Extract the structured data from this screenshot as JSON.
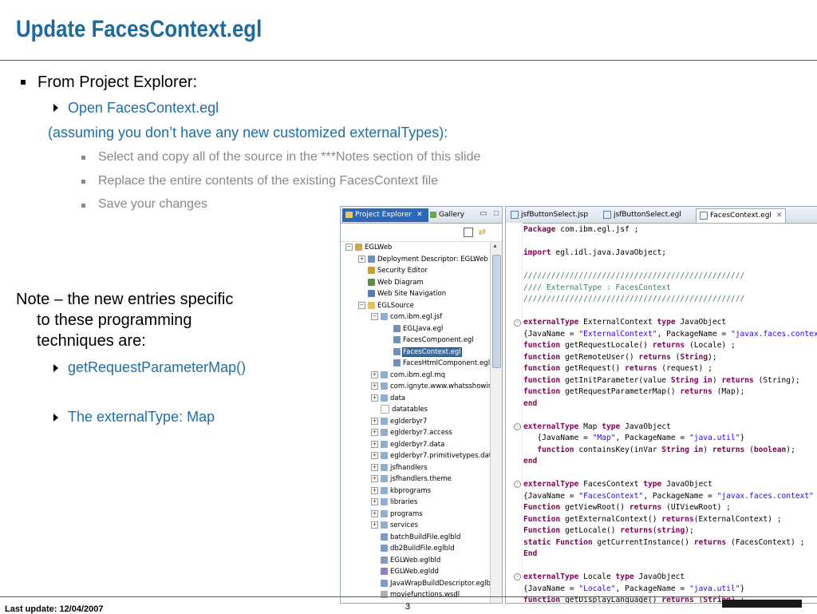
{
  "slide": {
    "title": "Update FacesContext.egl",
    "footer_left": "Last update: 12/04/2007",
    "page_number": "3"
  },
  "bullets": {
    "b1": "From Project Explorer:",
    "b1_sub1": "Open FacesContext.egl",
    "b1_note": "(assuming you don’t have any new customized externalTypes):",
    "b1_sub2_1": "Select  and copy all of the source in the ***Notes section of this slide",
    "b1_sub2_2": "Replace the entire contents of the existing FacesContext file",
    "b1_sub2_3": "Save your changes",
    "note_line1": "Note – the new entries specific",
    "note_line2": "to these programming",
    "note_line3": "techniques are:",
    "note_sub1": "getRequestParameterMap()",
    "note_sub2": "The externalType: Map"
  },
  "project_explorer": {
    "tab_active": "Project Explorer",
    "tab_other": "Gallery",
    "tree": [
      {
        "label": "EGLWeb",
        "indent": 0,
        "expander": "−",
        "icon": "project"
      },
      {
        "label": "Deployment Descriptor: EGLWeb",
        "indent": 1,
        "expander": "+",
        "icon": "descriptor"
      },
      {
        "label": "Security Editor",
        "indent": 1,
        "expander": "",
        "icon": "security"
      },
      {
        "label": "Web Diagram",
        "indent": 1,
        "expander": "",
        "icon": "diagram"
      },
      {
        "label": "Web Site Navigation",
        "indent": 1,
        "expander": "",
        "icon": "navigation"
      },
      {
        "label": "EGLSource",
        "indent": 1,
        "expander": "−",
        "icon": "folder"
      },
      {
        "label": "com.ibm.egl.jsf",
        "indent": 2,
        "expander": "−",
        "icon": "package"
      },
      {
        "label": "EGLJava.egl",
        "indent": 3,
        "expander": "",
        "icon": "file"
      },
      {
        "label": "FacesComponent.egl",
        "indent": 3,
        "expander": "",
        "icon": "file"
      },
      {
        "label": "FacesContext.egl",
        "indent": 3,
        "expander": "",
        "icon": "file",
        "selected": true
      },
      {
        "label": "FacesHtmlComponent.egl",
        "indent": 3,
        "expander": "",
        "icon": "file"
      },
      {
        "label": "com.ibm.egl.mq",
        "indent": 2,
        "expander": "+",
        "icon": "package"
      },
      {
        "label": "com.ignyte.www.whatsshowing",
        "indent": 2,
        "expander": "+",
        "icon": "package"
      },
      {
        "label": "data",
        "indent": 2,
        "expander": "+",
        "icon": "package"
      },
      {
        "label": "datatables",
        "indent": 2,
        "expander": "",
        "icon": "package-empty"
      },
      {
        "label": "eglderbyr7",
        "indent": 2,
        "expander": "+",
        "icon": "package"
      },
      {
        "label": "eglderbyr7.access",
        "indent": 2,
        "expander": "+",
        "icon": "package"
      },
      {
        "label": "eglderbyr7.data",
        "indent": 2,
        "expander": "+",
        "icon": "package"
      },
      {
        "label": "eglderbyr7.primitivetypes.data",
        "indent": 2,
        "expander": "+",
        "icon": "package"
      },
      {
        "label": "jsfhandlers",
        "indent": 2,
        "expander": "+",
        "icon": "package"
      },
      {
        "label": "jsfhandlers.theme",
        "indent": 2,
        "expander": "+",
        "icon": "package"
      },
      {
        "label": "kbprograms",
        "indent": 2,
        "expander": "+",
        "icon": "package"
      },
      {
        "label": "libraries",
        "indent": 2,
        "expander": "+",
        "icon": "package"
      },
      {
        "label": "programs",
        "indent": 2,
        "expander": "+",
        "icon": "package"
      },
      {
        "label": "services",
        "indent": 2,
        "expander": "+",
        "icon": "package"
      },
      {
        "label": "batchBuildFile.eglbld",
        "indent": 2,
        "expander": "",
        "icon": "build"
      },
      {
        "label": "db2BuildFile.eglbld",
        "indent": 2,
        "expander": "",
        "icon": "build"
      },
      {
        "label": "EGLWeb.eglbld",
        "indent": 2,
        "expander": "",
        "icon": "build"
      },
      {
        "label": "EGLWeb.egldd",
        "indent": 2,
        "expander": "",
        "icon": "deploy"
      },
      {
        "label": "JavaWrapBuildDescriptor.eglbld",
        "indent": 2,
        "expander": "",
        "icon": "build"
      },
      {
        "label": "moviefunctions.wsdl",
        "indent": 2,
        "expander": "",
        "icon": "wsdl"
      }
    ]
  },
  "editor": {
    "tabs": [
      "jsfButtonSelect.jsp",
      "jsfButtonSelect.egl",
      "FacesContext.egl"
    ],
    "active_tab": "FacesContext.egl",
    "lines": [
      [
        [
          "kw",
          "Package"
        ],
        [
          "",
          " com.ibm.egl.jsf ;"
        ]
      ],
      [
        [
          "",
          ""
        ]
      ],
      [
        [
          "kw",
          "import"
        ],
        [
          "",
          " egl.idl.java.JavaObject;"
        ]
      ],
      [
        [
          "",
          ""
        ]
      ],
      [
        [
          "cm",
          "////////////////////////////////////////////////"
        ]
      ],
      [
        [
          "cm",
          "//// ExternalType : FacesContext"
        ]
      ],
      [
        [
          "cm",
          "////////////////////////////////////////////////"
        ]
      ],
      [
        [
          "",
          ""
        ]
      ],
      [
        [
          "kw",
          "externalType"
        ],
        [
          "",
          " ExternalContext "
        ],
        [
          "kw",
          "type"
        ],
        [
          "",
          " JavaObject"
        ]
      ],
      [
        [
          "",
          "{JavaName = "
        ],
        [
          "str",
          "\"ExternalContext\""
        ],
        [
          "",
          ", PackageName = "
        ],
        [
          "str",
          "\"javax.faces.context\""
        ]
      ],
      [
        [
          "kw",
          "function"
        ],
        [
          "",
          " getRequestLocale() "
        ],
        [
          "kw",
          "returns"
        ],
        [
          "",
          " (Locale) ;"
        ]
      ],
      [
        [
          "kw",
          "function"
        ],
        [
          "",
          " getRemoteUser() "
        ],
        [
          "kw",
          "returns"
        ],
        [
          "",
          " ("
        ],
        [
          "kw",
          "String"
        ],
        [
          "",
          ");"
        ]
      ],
      [
        [
          "kw",
          "function"
        ],
        [
          "",
          " getRequest() "
        ],
        [
          "kw",
          "returns"
        ],
        [
          "",
          " (request) ;"
        ]
      ],
      [
        [
          "kw",
          "function"
        ],
        [
          "",
          " getInitParameter(value "
        ],
        [
          "kw",
          "String"
        ],
        [
          "",
          " "
        ],
        [
          "kw",
          "in"
        ],
        [
          "",
          ") "
        ],
        [
          "kw",
          "returns"
        ],
        [
          "",
          " (String);"
        ]
      ],
      [
        [
          "kw",
          "function"
        ],
        [
          "",
          " getRequestParameterMap() "
        ],
        [
          "kw",
          "returns"
        ],
        [
          "",
          " (Map);"
        ]
      ],
      [
        [
          "kw",
          "end"
        ]
      ],
      [
        [
          "",
          ""
        ]
      ],
      [
        [
          "kw",
          "externalType"
        ],
        [
          "",
          " Map "
        ],
        [
          "kw",
          "type"
        ],
        [
          "",
          " JavaObject"
        ]
      ],
      [
        [
          "",
          "   {JavaName = "
        ],
        [
          "str",
          "\"Map\""
        ],
        [
          "",
          ", PackageName = "
        ],
        [
          "str",
          "\"java.util\""
        ],
        [
          "",
          "}"
        ]
      ],
      [
        [
          "",
          "   "
        ],
        [
          "kw",
          "function"
        ],
        [
          "",
          " containsKey(inVar "
        ],
        [
          "kw",
          "String"
        ],
        [
          "",
          " "
        ],
        [
          "kw",
          "in"
        ],
        [
          "",
          ") "
        ],
        [
          "kw",
          "returns"
        ],
        [
          "",
          " ("
        ],
        [
          "kw",
          "boolean"
        ],
        [
          "",
          ");"
        ]
      ],
      [
        [
          "kw",
          "end"
        ]
      ],
      [
        [
          "",
          ""
        ]
      ],
      [
        [
          "kw",
          "externalType"
        ],
        [
          "",
          " FacesContext "
        ],
        [
          "kw",
          "type"
        ],
        [
          "",
          " JavaObject"
        ]
      ],
      [
        [
          "",
          "{JavaName = "
        ],
        [
          "str",
          "\"FacesContext\""
        ],
        [
          "",
          ", PackageName = "
        ],
        [
          "str",
          "\"javax.faces.context\""
        ]
      ],
      [
        [
          "kw",
          "Function"
        ],
        [
          "",
          " getViewRoot() "
        ],
        [
          "kw",
          "returns"
        ],
        [
          "",
          " (UIViewRoot) ;"
        ]
      ],
      [
        [
          "kw",
          "Function"
        ],
        [
          "",
          " getExternalContext() "
        ],
        [
          "kw",
          "returns"
        ],
        [
          "",
          "(ExternalContext) ;"
        ]
      ],
      [
        [
          "kw",
          "Function"
        ],
        [
          "",
          " getLocale() "
        ],
        [
          "kw",
          "returns"
        ],
        [
          "",
          "("
        ],
        [
          "kw",
          "string"
        ],
        [
          "",
          ");"
        ]
      ],
      [
        [
          "kw",
          "static"
        ],
        [
          "",
          " "
        ],
        [
          "kw",
          "Function"
        ],
        [
          "",
          " getCurrentInstance() "
        ],
        [
          "kw",
          "returns"
        ],
        [
          "",
          " (FacesContext) ;"
        ]
      ],
      [
        [
          "kw",
          "End"
        ]
      ],
      [
        [
          "",
          ""
        ]
      ],
      [
        [
          "kw",
          "externalType"
        ],
        [
          "",
          " Locale "
        ],
        [
          "kw",
          "type"
        ],
        [
          "",
          " JavaObject"
        ]
      ],
      [
        [
          "",
          "{JavaName = "
        ],
        [
          "str",
          "\"Locale\""
        ],
        [
          "",
          ", PackageName = "
        ],
        [
          "str",
          "\"java.util\""
        ],
        [
          "",
          "}"
        ]
      ],
      [
        [
          "kw",
          "function"
        ],
        [
          "",
          " getDisplayLanguage() "
        ],
        [
          "kw",
          "returns"
        ],
        [
          "",
          " ("
        ],
        [
          "kw",
          "String"
        ],
        [
          "",
          ") ;"
        ]
      ]
    ]
  },
  "colors": {
    "title": "#1d6aa0",
    "link_blue": "#1f6ea8",
    "keyword": "#7f0055",
    "string": "#2a00ff",
    "comment": "#3f7f5f",
    "selection": "#3a6ea5"
  }
}
